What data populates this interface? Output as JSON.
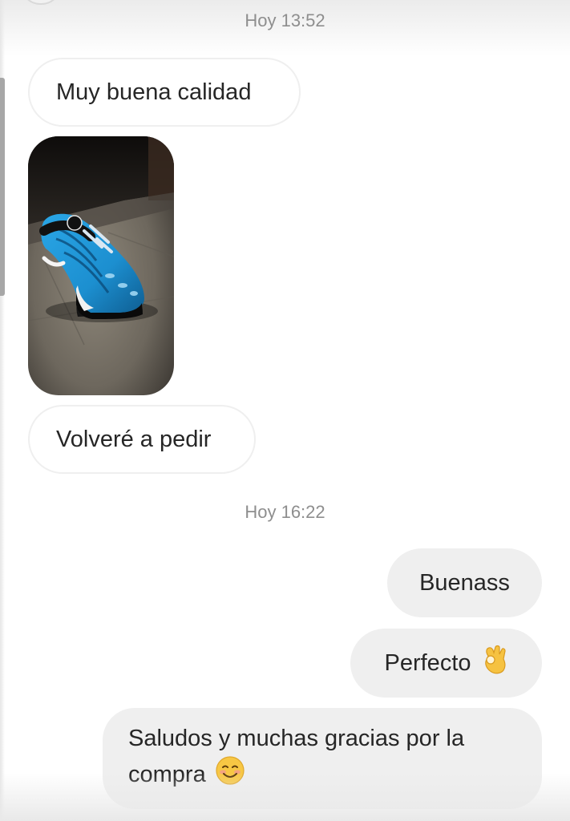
{
  "conversation": {
    "timestamp_1": "Hoy 13:52",
    "timestamp_2": "Hoy 16:22",
    "messages": {
      "m1": "Muy buena calidad",
      "m2": "Volveré a pedir",
      "m3": "Buenass",
      "m4": "Perfecto",
      "m5": "Saludos y muchas gracias por la compra"
    },
    "emojis": {
      "ok_hand": "ok-hand-icon",
      "smile": "smiling-face-icon"
    },
    "colors": {
      "incoming_bubble": "#ffffff",
      "outgoing_bubble": "#efefef",
      "timestamp_text": "#8e8e8e",
      "message_text": "#262626",
      "shoe_blue": "#1c8fd0"
    }
  }
}
